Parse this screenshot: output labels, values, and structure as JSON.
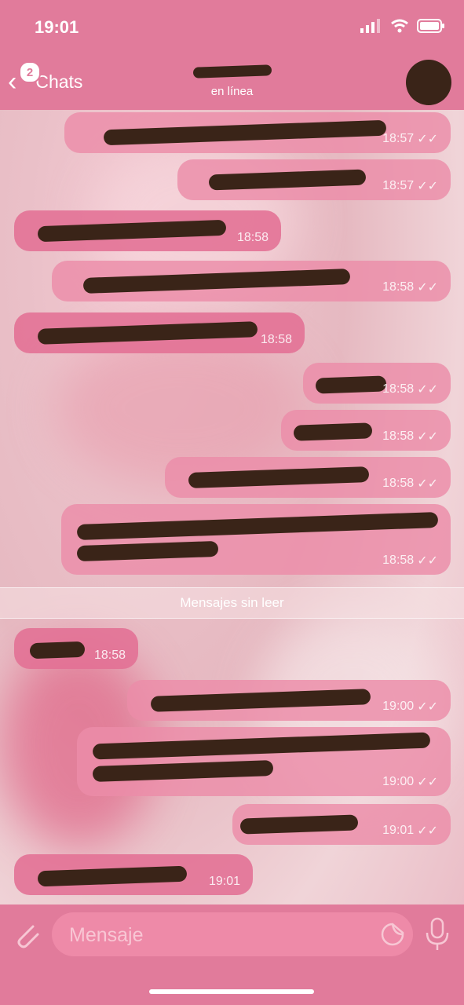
{
  "status_bar": {
    "time": "19:01"
  },
  "nav": {
    "back_label": "Chats",
    "unread_count": "2",
    "subtitle": "en línea"
  },
  "messages": [
    {
      "dir": "out",
      "time": "18:57"
    },
    {
      "dir": "out",
      "time": "18:57"
    },
    {
      "dir": "in",
      "time": "18:58"
    },
    {
      "dir": "out",
      "time": "18:58"
    },
    {
      "dir": "in",
      "time": "18:58"
    },
    {
      "dir": "out",
      "time": "18:58"
    },
    {
      "dir": "out",
      "time": "18:58"
    },
    {
      "dir": "out",
      "time": "18:58"
    },
    {
      "dir": "out",
      "time": "18:58"
    },
    {
      "dir": "in",
      "time": "18:58"
    },
    {
      "dir": "out",
      "time": "19:00"
    },
    {
      "dir": "out",
      "time": "19:00"
    },
    {
      "dir": "out",
      "time": "19:01"
    },
    {
      "dir": "in",
      "time": "19:01"
    }
  ],
  "unread_divider": "Mensajes sin leer",
  "input": {
    "placeholder": "Mensaje"
  },
  "icons": {
    "attach": "paperclip-icon",
    "sticker": "sticker-icon",
    "mic": "microphone-icon",
    "read": "double-check-icon"
  },
  "colors": {
    "bar": "#e17b9b",
    "bubble_out": "#ec8ca8",
    "bubble_in": "#e37094"
  }
}
